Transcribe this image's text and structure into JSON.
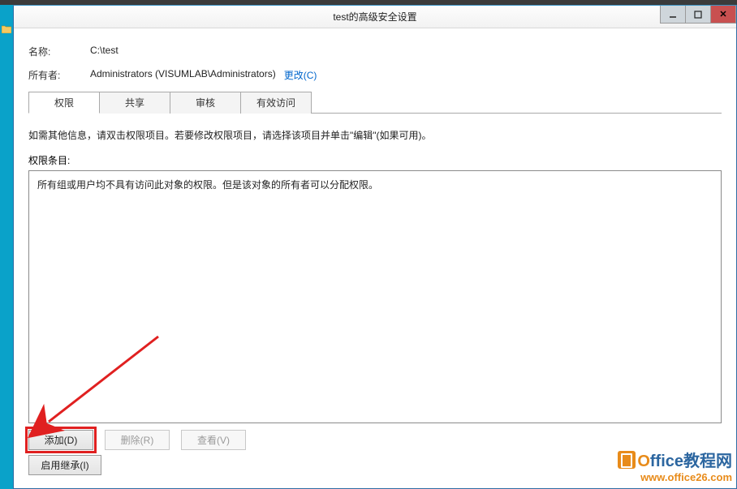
{
  "window": {
    "title": "test的高级安全设置"
  },
  "info": {
    "name_label": "名称:",
    "name_value": "C:\\test",
    "owner_label": "所有者:",
    "owner_value": "Administrators (VISUMLAB\\Administrators)",
    "change_link": "更改(C)"
  },
  "tabs": {
    "permissions": "权限",
    "sharing": "共享",
    "auditing": "审核",
    "effective": "有效访问"
  },
  "instruction_text": "如需其他信息，请双击权限项目。若要修改权限项目，请选择该项目并单击\"编辑\"(如果可用)。",
  "entries": {
    "label": "权限条目:",
    "message": "所有组或用户均不具有访问此对象的权限。但是该对象的所有者可以分配权限。"
  },
  "buttons": {
    "add": "添加(D)",
    "remove": "删除(R)",
    "view": "查看(V)",
    "enable_inherit": "启用继承(I)"
  },
  "watermark": {
    "line1_prefix": "O",
    "line1_rest": "ffice教程网",
    "line2": "www.office26.com"
  }
}
